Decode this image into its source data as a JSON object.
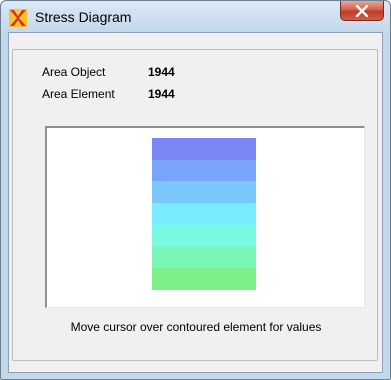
{
  "window": {
    "title": "Stress Diagram",
    "icon": "sap-logo-icon",
    "close_icon": "close-icon"
  },
  "info": {
    "area_object_label": "Area Object",
    "area_object_value": "1944",
    "area_element_label": "Area Element",
    "area_element_value": "1944"
  },
  "contour": {
    "band_colors": [
      "#7d86f5",
      "#7aa4fa",
      "#7ac8fb",
      "#78ecfd",
      "#78fae0",
      "#7af7b6",
      "#7fef8a"
    ]
  },
  "hint_text": "Move cursor over contoured element for values"
}
